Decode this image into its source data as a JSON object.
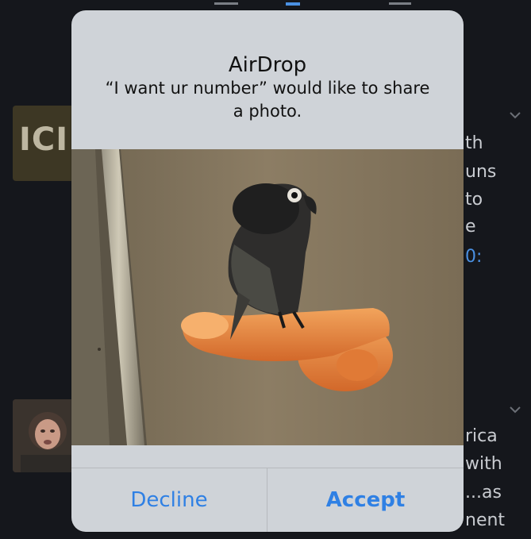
{
  "background_feed": {
    "logo_text": "ICI",
    "right_fragments": [
      "th",
      "uns",
      "to",
      "e",
      "0:"
    ],
    "right_fragments_2": [
      "rica",
      "with",
      "...as",
      "nent"
    ]
  },
  "dialog": {
    "title": "AirDrop",
    "message": "“I want ur number” would like to share a photo.",
    "decline_label": "Decline",
    "accept_label": "Accept"
  },
  "colors": {
    "accent": "#2f80e4",
    "dialog_bg": "#cfd3d8",
    "page_bg": "#15171c"
  }
}
